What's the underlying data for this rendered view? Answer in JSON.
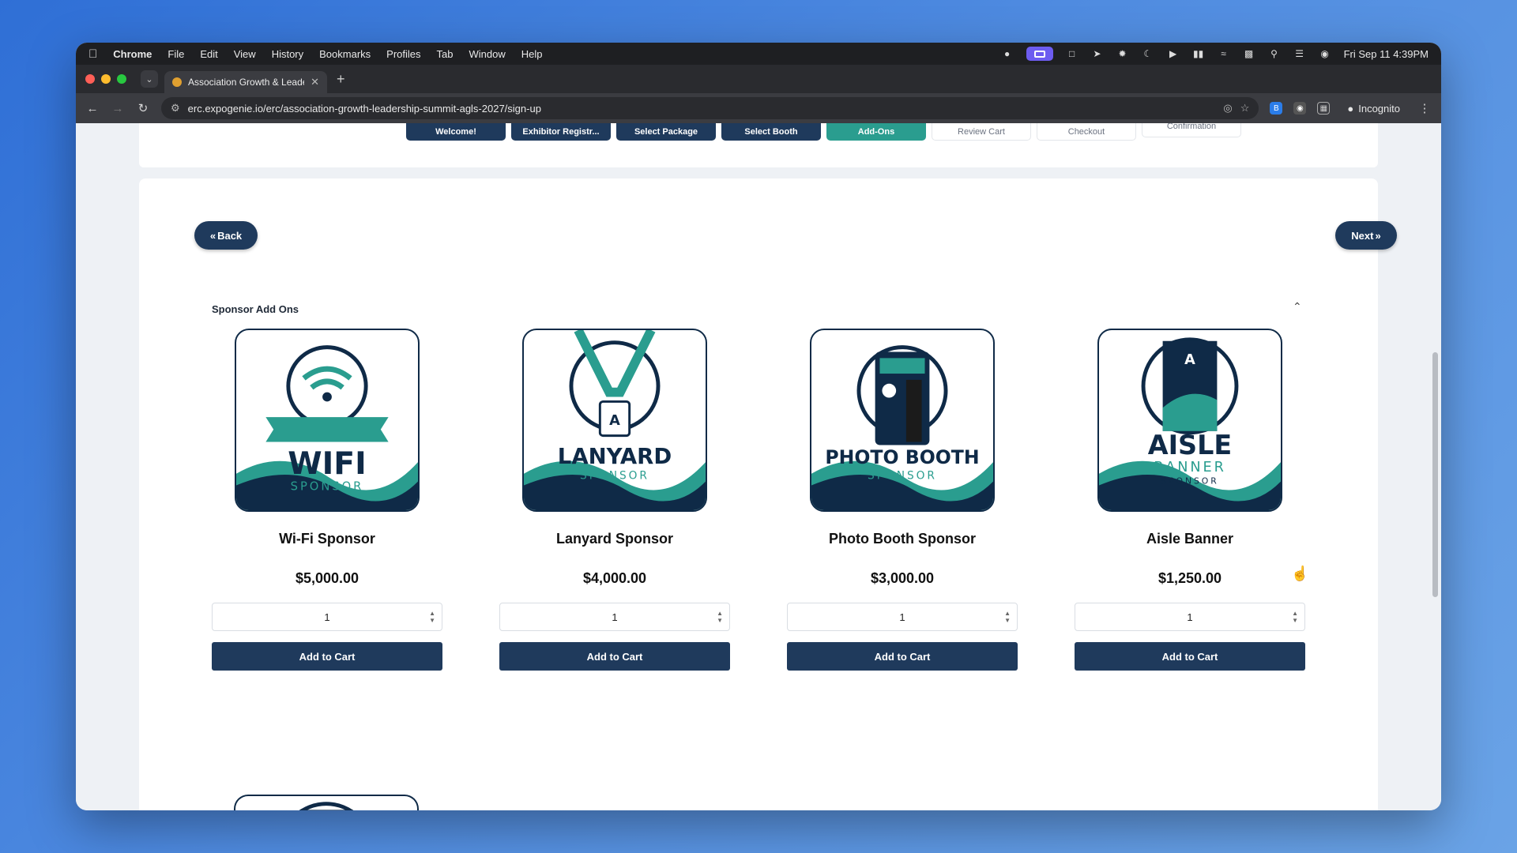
{
  "menubar": {
    "app": "Chrome",
    "items": [
      "File",
      "Edit",
      "View",
      "History",
      "Bookmarks",
      "Profiles",
      "Tab",
      "Window",
      "Help"
    ],
    "datetime": "Fri Sep 11  4:39PM"
  },
  "browser": {
    "tab_title": "Association Growth & Leader:",
    "url": "erc.expogenie.io/erc/association-growth-leadership-summit-agls-2027/sign-up",
    "incognito_label": "Incognito"
  },
  "steps": [
    {
      "label": "Welcome!",
      "state": "done"
    },
    {
      "label": "Exhibitor Registr...",
      "state": "done"
    },
    {
      "label": "Select Package",
      "state": "done"
    },
    {
      "label": "Select Booth",
      "state": "done"
    },
    {
      "label": "Add-Ons",
      "state": "active"
    },
    {
      "label": "Review Cart",
      "state": "pending"
    },
    {
      "label": "Checkout",
      "state": "pending"
    },
    {
      "label": "Confirmation",
      "state": "pending"
    }
  ],
  "nav": {
    "back_label": "Back",
    "next_label": "Next"
  },
  "section": {
    "title": "Sponsor Add Ons"
  },
  "products": [
    {
      "name": "Wi-Fi Sponsor",
      "price": "$5,000.00",
      "qty": "1",
      "button": "Add to Cart",
      "logo_line1": "WIFI",
      "logo_line2": "SPONSOR"
    },
    {
      "name": "Lanyard Sponsor",
      "price": "$4,000.00",
      "qty": "1",
      "button": "Add to Cart",
      "logo_line1": "LANYARD",
      "logo_line2": "SPONSOR"
    },
    {
      "name": "Photo Booth Sponsor",
      "price": "$3,000.00",
      "qty": "1",
      "button": "Add to Cart",
      "logo_line1": "PHOTO BOOTH",
      "logo_line2": "SPONSOR"
    },
    {
      "name": "Aisle Banner",
      "price": "$1,250.00",
      "qty": "1",
      "button": "Add to Cart",
      "logo_line1": "AISLE",
      "logo_line2": "BANNER",
      "logo_line3": "SPONSOR"
    }
  ],
  "colors": {
    "navy": "#1f3a5c",
    "teal": "#2a9d8f",
    "page_bg": "#eef1f5"
  }
}
